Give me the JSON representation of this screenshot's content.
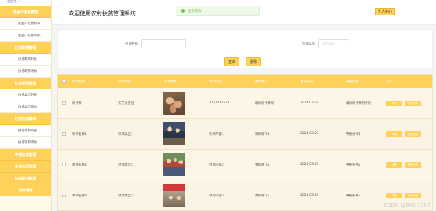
{
  "sidebar": {
    "top_text": "注册用户",
    "items": [
      {
        "type": "group",
        "label": "贫困户信息管理"
      },
      {
        "type": "item",
        "label": "贫困户信息列表"
      },
      {
        "type": "item",
        "label": "贫困户信息添加"
      },
      {
        "type": "group",
        "label": "扶贫政策管理"
      },
      {
        "type": "item",
        "label": "扶贫政策列表"
      },
      {
        "type": "item",
        "label": "扶贫政策添加"
      },
      {
        "type": "group",
        "label": "扶贫类型管理"
      },
      {
        "type": "item",
        "label": "扶贫类型列表"
      },
      {
        "type": "item",
        "label": "扶贫类型添加"
      },
      {
        "type": "group",
        "label": "扶贫项目管理"
      },
      {
        "type": "item",
        "label": "扶贫项目列表"
      },
      {
        "type": "item",
        "label": "扶贫项目添加"
      },
      {
        "type": "group",
        "label": "申报信息管理"
      },
      {
        "type": "group",
        "label": "资金分配管理"
      },
      {
        "type": "group",
        "label": "扶贫留言管理"
      },
      {
        "type": "group",
        "label": "系统管理"
      }
    ]
  },
  "header": {
    "title": "欢迎使用农村扶贫管理系统",
    "toast": "提示成功!",
    "user_center": "个人中心"
  },
  "search": {
    "name_label": "项目名称",
    "name_placeholder": "",
    "type_label": "项目类型",
    "type_placeholder": "项目类型",
    "query_button": "查询",
    "delete_button": "删除"
  },
  "table": {
    "headers": [
      "项目名称",
      "项目类型",
      "项目图片",
      "项目内容",
      "项目简介",
      "发布时间",
      "申报条件",
      "操作"
    ],
    "rows": [
      {
        "name": "阿什顿",
        "type": "方方扶贫经",
        "content": "1213231231",
        "intro": "请问阿什顿啊",
        "date": "2024-03-29",
        "condition": "请问阿什顿阿什顿",
        "img": "pigs"
      },
      {
        "name": "项目名称1",
        "type": "项目类型1",
        "content": "项目内容1",
        "intro": "项目简介1",
        "date": "2024-03-29",
        "condition": "申报条件1",
        "img": "people"
      },
      {
        "name": "项目名称2",
        "type": "项目类型2",
        "content": "项目内容2",
        "intro": "项目简介2",
        "date": "2024-03-29",
        "condition": "申报条件2",
        "img": "group"
      },
      {
        "name": "项目名称3",
        "type": "项目类型3",
        "content": "项目内容3",
        "intro": "项目简介3",
        "date": "2024-03-29",
        "condition": "申报条件3",
        "img": "banner"
      }
    ],
    "action_edit": "详情",
    "action_delete": "修改信息"
  },
  "watermark": "CSDN @BYSJ1987",
  "colors": {
    "accent": "#fed25a",
    "toast_green": "#67c23a"
  }
}
